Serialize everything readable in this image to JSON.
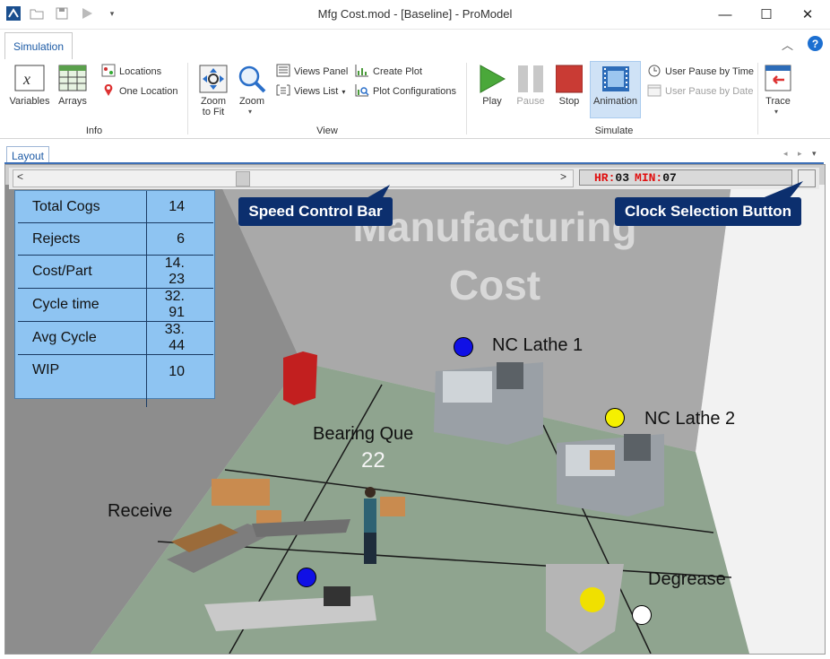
{
  "window": {
    "title": "Mfg Cost.mod - [Baseline] - ProModel",
    "minimize": "—",
    "maximize": "☐",
    "close": "✕"
  },
  "ribbon": {
    "tabs": [
      {
        "label": "Simulation"
      }
    ],
    "groups": {
      "info": {
        "label": "Info",
        "variables": "Variables",
        "arrays": "Arrays",
        "locations": "Locations",
        "one_location": "One Location"
      },
      "view": {
        "label": "View",
        "zoom_to_fit_line1": "Zoom",
        "zoom_to_fit_line2": "to Fit",
        "zoom": "Zoom",
        "views_panel": "Views Panel",
        "views_list": "Views List",
        "create_plot": "Create Plot",
        "plot_configurations": "Plot Configurations"
      },
      "simulate": {
        "label": "Simulate",
        "play": "Play",
        "pause": "Pause",
        "stop": "Stop",
        "animation": "Animation",
        "user_pause_by_time": "User Pause by Time",
        "user_pause_by_date": "User Pause by Date"
      },
      "trace": {
        "label": "Trace"
      }
    }
  },
  "layout": {
    "tab_label": "Layout",
    "clock": {
      "hr_label": "HR:",
      "hr_value": "03",
      "min_label": "MIN:",
      "min_value": "07"
    },
    "callouts": {
      "speed_control": "Speed Control Bar",
      "clock_selection": "Clock Selection Button"
    },
    "scene": {
      "title_line1": "Manufacturing",
      "title_line2": "Cost",
      "nc_lathe_1": "NC Lathe 1",
      "nc_lathe_2": "NC Lathe 2",
      "bearing_que": "Bearing Que",
      "bearing_que_count": "22",
      "receive": "Receive",
      "degrease": "Degrease"
    },
    "stats": [
      {
        "label": "Total Cogs",
        "value": "14"
      },
      {
        "label": "Rejects",
        "value": "6"
      },
      {
        "label": "Cost/Part",
        "value": "14. 23"
      },
      {
        "label": "Cycle time",
        "value": "32. 91"
      },
      {
        "label": "Avg Cycle",
        "value": "33. 44"
      },
      {
        "label": "WIP",
        "value": "10"
      }
    ]
  },
  "colors": {
    "accent": "#1c5aa5",
    "callout_bg": "#0c2f6e",
    "stats_bg": "#8ec4f2",
    "floor": "#8fa48f",
    "play_green": "#4aa83a",
    "stop_red": "#c0392b",
    "clock_red": "#e01010"
  }
}
